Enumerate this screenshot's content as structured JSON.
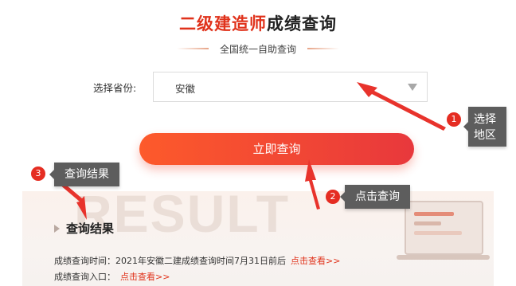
{
  "header": {
    "title_red": "二级建造师",
    "title_dark": "成绩查询",
    "subtitle": "全国统一自助查询"
  },
  "form": {
    "province_label": "选择省份:",
    "province_value": "安徽",
    "query_button": "立即查询"
  },
  "result": {
    "watermark": "RESULT",
    "heading": "查询结果",
    "time_text": "成绩查询时间：2021年安徽二建成绩查询时间7月31日前后",
    "time_link": "点击查看>>",
    "entry_text": "成绩查询入口：",
    "entry_link": "点击查看>>"
  },
  "annotations": [
    {
      "number": "1",
      "text": "选择\n地区"
    },
    {
      "number": "2",
      "text": "点击查询"
    },
    {
      "number": "3",
      "text": "查询结果"
    }
  ],
  "colors": {
    "accent_red": "#e0321b",
    "button_gradient_start": "#fd5a2b",
    "button_gradient_end": "#e8383c",
    "callout_bg": "#5d5d5d",
    "badge_red": "#e52d22"
  }
}
